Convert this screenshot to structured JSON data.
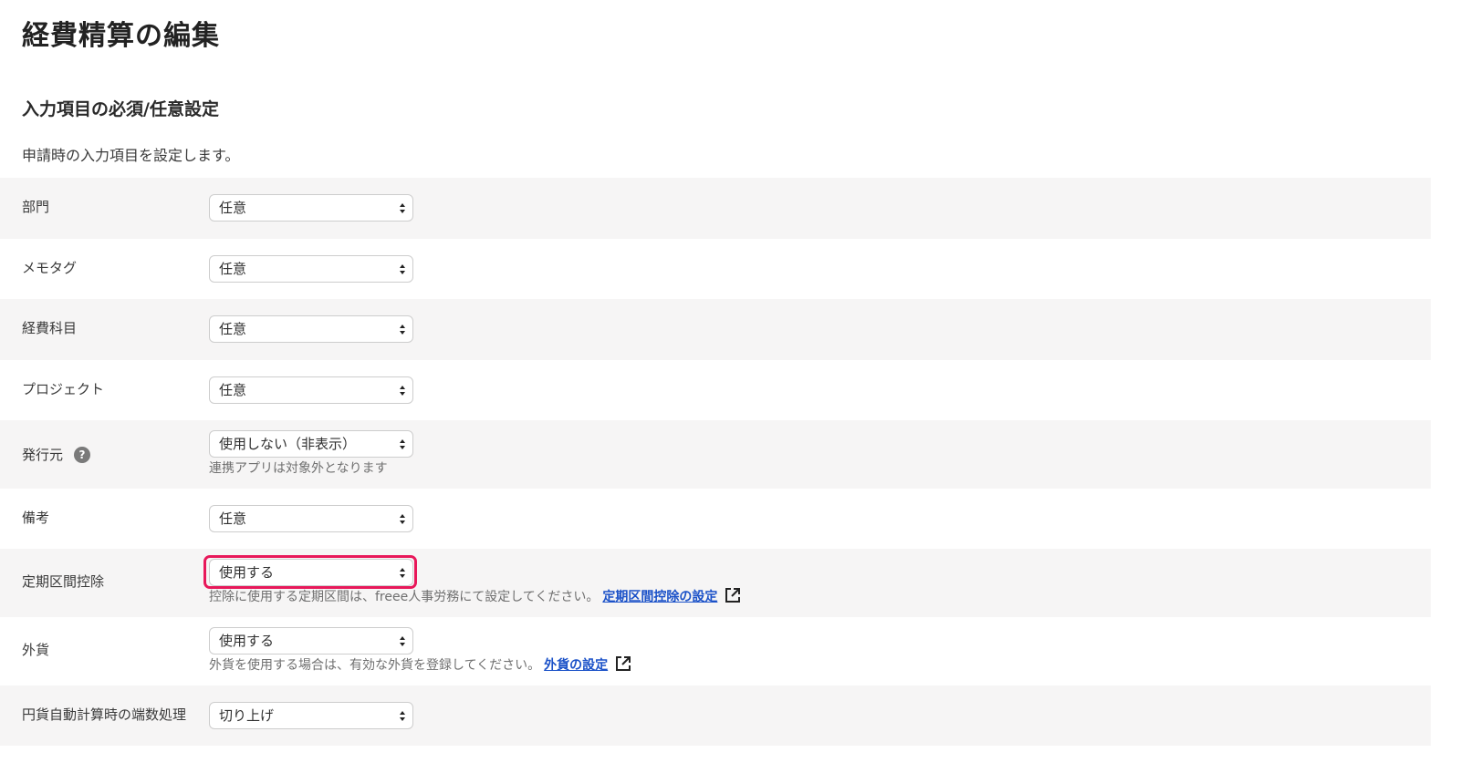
{
  "page": {
    "title": "経費精算の編集"
  },
  "section": {
    "title": "入力項目の必須/任意設定",
    "description": "申請時の入力項目を設定します。"
  },
  "settings": [
    {
      "label": "部門",
      "value": "任意"
    },
    {
      "label": "メモタグ",
      "value": "任意"
    },
    {
      "label": "経費科目",
      "value": "任意"
    },
    {
      "label": "プロジェクト",
      "value": "任意"
    },
    {
      "label": "発行元",
      "value": "使用しない（非表示）",
      "help_icon": "question-icon",
      "help_text": "連携アプリは対象外となります"
    },
    {
      "label": "備考",
      "value": "任意"
    },
    {
      "label": "定期区間控除",
      "value": "使用する",
      "highlighted": true,
      "help_text": "控除に使用する定期区間は、freee人事労務にて設定してください。",
      "link_text": "定期区間控除の設定",
      "link_icon": "external-link-icon"
    },
    {
      "label": "外貨",
      "value": "使用する",
      "help_text": "外貨を使用する場合は、有効な外貨を登録してください。",
      "link_text": "外貨の設定",
      "link_icon": "external-link-icon"
    },
    {
      "label": "円貨自動計算時の端数処理",
      "value": "切り上げ"
    }
  ],
  "colors": {
    "row_shaded": "#f6f5f5",
    "highlight_border": "#e8185a",
    "link": "#1a51c8"
  }
}
